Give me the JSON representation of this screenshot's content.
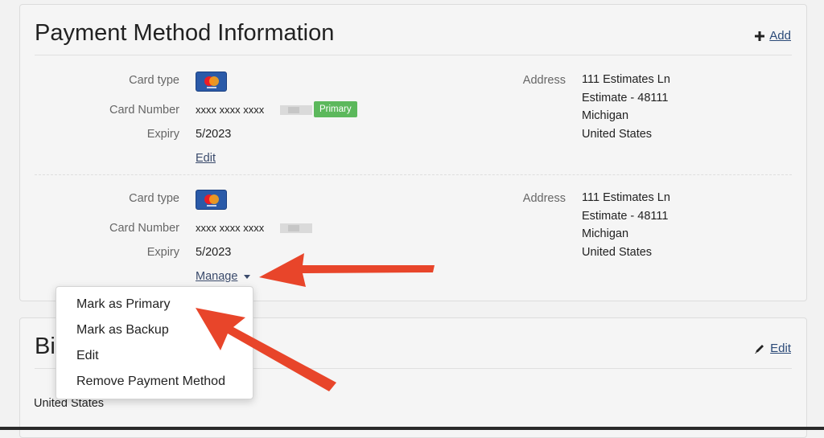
{
  "payment_section": {
    "title": "Payment Method Information",
    "add_label": "Add",
    "labels": {
      "card_type": "Card type",
      "card_number": "Card Number",
      "expiry": "Expiry",
      "address": "Address"
    },
    "cards": [
      {
        "card_number": "xxxx xxxx xxxx",
        "badge": "Primary",
        "expiry": "5/2023",
        "action_label": "Edit",
        "address": [
          "111 Estimates Ln",
          "Estimate - 48111",
          "Michigan",
          "United States"
        ]
      },
      {
        "card_number": "xxxx xxxx xxxx",
        "expiry": "5/2023",
        "action_label": "Manage",
        "address": [
          "111 Estimates Ln",
          "Estimate - 48111",
          "Michigan",
          "United States"
        ]
      }
    ],
    "card_brand_icon": "mastercard-icon"
  },
  "manage_menu": {
    "items": [
      "Mark as Primary",
      "Mark as Backup",
      "Edit",
      "Remove Payment Method"
    ]
  },
  "billing_section": {
    "title_partial": "Bi",
    "edit_label": "Edit",
    "country": "United States"
  },
  "colors": {
    "badge_green": "#5cb85c",
    "arrow_red": "#e8452a",
    "link": "#2b4a78"
  }
}
